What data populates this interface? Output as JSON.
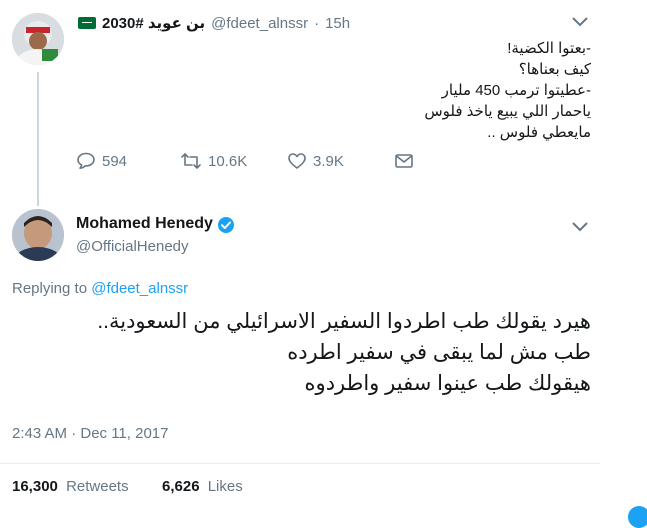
{
  "parent_tweet": {
    "display_name": "بن عويد #2030",
    "handle": "@fdeet_alnssr",
    "separator": "·",
    "time": "15h",
    "text_lines": [
      "-بعتوا الكضية!",
      "كيف بعناها؟",
      "-عطيتوا ترمب 450 مليار",
      "ياحمار  اللي يبيع ياخذ فلوس",
      "مايعطي فلوس .."
    ],
    "reply_count": "594",
    "retweet_count": "10.6K",
    "like_count": "3.9K"
  },
  "main_tweet": {
    "display_name": "Mohamed Henedy",
    "handle": "@OfficialHenedy",
    "replying_prefix": "Replying to",
    "replying_handle": "@fdeet_alnssr",
    "text_lines": [
      "هيرد يقولك طب اطردوا السفير الاسرائيلي من السعودية..",
      "طب مش لما يبقى في سفير اطرده",
      "هيقولك طب عينوا سفير واطردوه"
    ],
    "timestamp": "2:43 AM · Dec 11, 2017",
    "retweets_count": "16,300",
    "retweets_label": "Retweets",
    "likes_count": "6,626",
    "likes_label": "Likes"
  },
  "colors": {
    "accent": "#1da1f2",
    "secondary_text": "#657786",
    "divider": "#e6ecf0",
    "thread_line": "#ccd6dd"
  },
  "icons": [
    "reply-icon",
    "retweet-icon",
    "like-icon",
    "dm-icon",
    "chevron-down-icon",
    "verified-icon",
    "saudi-flag-icon"
  ]
}
